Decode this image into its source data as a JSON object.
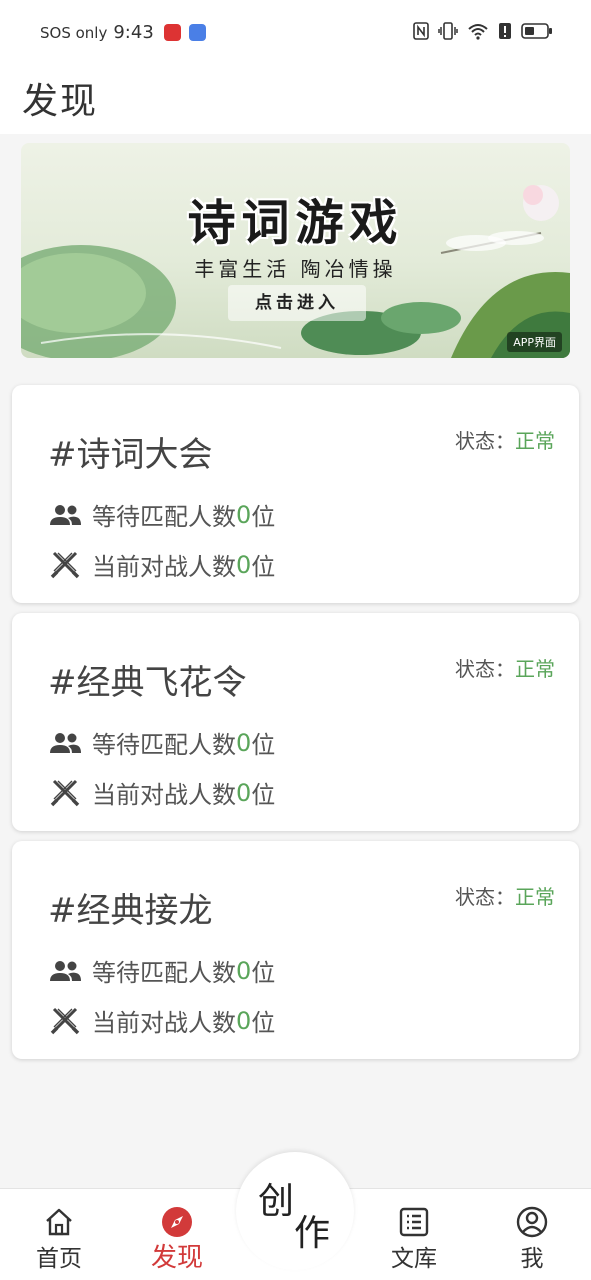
{
  "status_bar": {
    "carrier": "SOS only",
    "time": "9:43",
    "battery": "battery-icon"
  },
  "header": {
    "title": "发现"
  },
  "banner": {
    "title": "诗词游戏",
    "subtitle": "丰富生活 陶冶情操",
    "button_label": "点击进入",
    "tag": "APP界面"
  },
  "cards": [
    {
      "title": "#诗词大会",
      "status_label": "状态：",
      "status_value": "正常",
      "wait_prefix": "等待匹配人数",
      "wait_count": "0",
      "wait_suffix": "位",
      "battle_prefix": "当前对战人数",
      "battle_count": "0",
      "battle_suffix": "位"
    },
    {
      "title": "#经典飞花令",
      "status_label": "状态：",
      "status_value": "正常",
      "wait_prefix": "等待匹配人数",
      "wait_count": "0",
      "wait_suffix": "位",
      "battle_prefix": "当前对战人数",
      "battle_count": "0",
      "battle_suffix": "位"
    },
    {
      "title": "#经典接龙",
      "status_label": "状态：",
      "status_value": "正常",
      "wait_prefix": "等待匹配人数",
      "wait_count": "0",
      "wait_suffix": "位",
      "battle_prefix": "当前对战人数",
      "battle_count": "0",
      "battle_suffix": "位"
    }
  ],
  "bottom_nav": {
    "home": "首页",
    "discover": "发现",
    "create_1": "创",
    "create_2": "作",
    "library": "文库",
    "me": "我"
  },
  "colors": {
    "accent_green": "#5aa55a",
    "active_red": "#d23a3a"
  }
}
